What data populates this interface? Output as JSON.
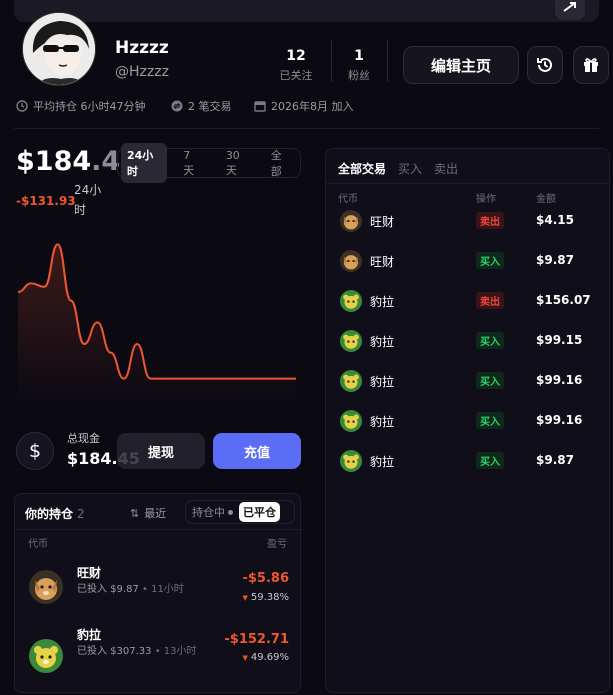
{
  "profile": {
    "name": "Hzzzz",
    "handle": "@Hzzzz",
    "following_count": "12",
    "following_label": "已关注",
    "followers_count": "1",
    "followers_label": "粉丝",
    "edit_button": "编辑主页"
  },
  "meta": {
    "avg_hold": "平均持仓 6小时47分钟",
    "trade_count": "2 笔交易",
    "joined": "2026年8月 加入"
  },
  "balance": {
    "integer": "$184",
    "decimal": ".45",
    "pnl": "-$131.93",
    "pnl_period": "24小时",
    "tabs": [
      "24小时",
      "7天",
      "30天",
      "全部"
    ],
    "active_tab": "24小时"
  },
  "chart_data": {
    "type": "area",
    "color": "#f0562f",
    "values": [
      260,
      270,
      266,
      315,
      250,
      200,
      225,
      190,
      160,
      200,
      160,
      160,
      160,
      160,
      160,
      160,
      160,
      160,
      160,
      160,
      160,
      160
    ]
  },
  "cash": {
    "label": "总现金",
    "value": "$184.45",
    "withdraw": "提现",
    "deposit": "充值"
  },
  "holdings": {
    "title": "你的持仓",
    "count": "2",
    "sort_label": "最近",
    "seg_open": "持仓中",
    "seg_closed": "已平仓",
    "col_token": "代币",
    "col_pnl": "盈亏",
    "items": [
      {
        "name": "旺财",
        "invested": "已投入 $9.87",
        "ago": "• 11小时",
        "pnl": "-$5.86",
        "pct": "59.38%",
        "coin": "dog"
      },
      {
        "name": "豹拉",
        "invested": "已投入 $307.33",
        "ago": "• 13小时",
        "pnl": "-$152.71",
        "pct": "49.69%",
        "coin": "bear"
      }
    ]
  },
  "trades": {
    "tabs": [
      "全部交易",
      "买入",
      "卖出"
    ],
    "col_token": "代币",
    "col_action": "操作",
    "col_amount": "金额",
    "rows": [
      {
        "name": "旺财",
        "action": "卖出",
        "type": "sell",
        "amount": "$4.15",
        "coin": "dog"
      },
      {
        "name": "旺财",
        "action": "买入",
        "type": "buy",
        "amount": "$9.87",
        "coin": "dog"
      },
      {
        "name": "豹拉",
        "action": "卖出",
        "type": "sell",
        "amount": "$156.07",
        "coin": "bear"
      },
      {
        "name": "豹拉",
        "action": "买入",
        "type": "buy",
        "amount": "$99.15",
        "coin": "bear"
      },
      {
        "name": "豹拉",
        "action": "买入",
        "type": "buy",
        "amount": "$99.16",
        "coin": "bear"
      },
      {
        "name": "豹拉",
        "action": "买入",
        "type": "buy",
        "amount": "$99.16",
        "coin": "bear"
      },
      {
        "name": "豹拉",
        "action": "买入",
        "type": "buy",
        "amount": "$9.87",
        "coin": "bear"
      }
    ]
  },
  "colors": {
    "background": "#0b0a13",
    "accent": "#5c6df5",
    "loss": "#f0562f",
    "buy": "#2bd16b",
    "sell": "#f0463a"
  }
}
